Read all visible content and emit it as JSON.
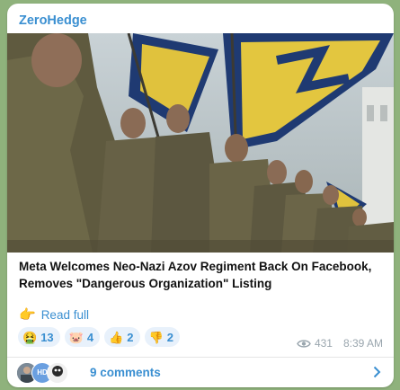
{
  "post": {
    "channel_name": "ZeroHedge",
    "headline": "Meta Welcomes Neo-Nazi Azov Regiment Back On Facebook, Removes \"Dangerous Organization\" Listing",
    "read_full_label": "Read full",
    "read_full_icon": "pointing-hand-icon",
    "reactions": [
      {
        "emoji": "🤮",
        "icon": "vomit-face-icon",
        "count": "13"
      },
      {
        "emoji": "🐷",
        "icon": "pig-icon",
        "count": "4"
      },
      {
        "emoji": "👍",
        "icon": "thumbs-up-icon",
        "count": "2"
      },
      {
        "emoji": "👎",
        "icon": "thumbs-down-icon",
        "count": "2"
      }
    ],
    "views": "431",
    "time": "8:39 AM",
    "comments_label": "9 comments",
    "avatar_initials": "HD"
  },
  "colors": {
    "background": "#8fb27c",
    "bubble": "#ffffff",
    "accent": "#3a8fd1",
    "reaction_bg": "#e8f1fb",
    "meta": "#9aa6ae"
  }
}
